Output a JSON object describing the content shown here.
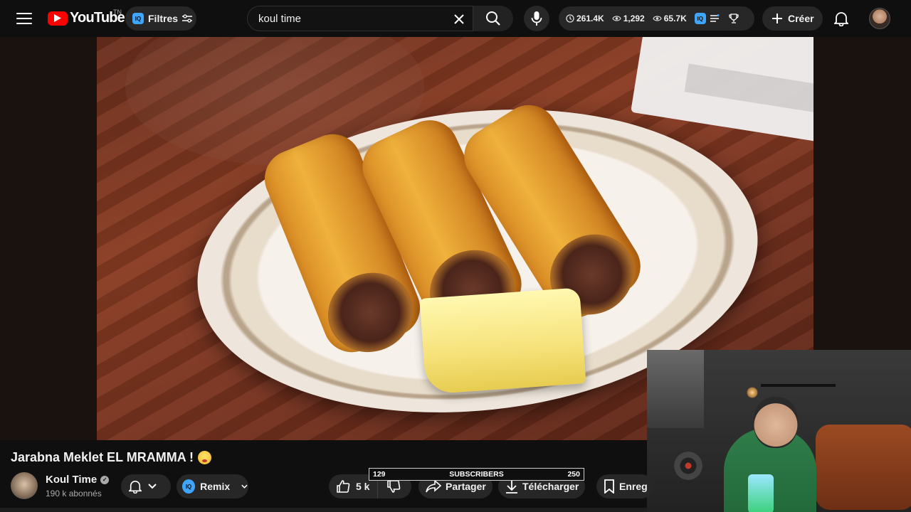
{
  "header": {
    "logo_text": "YouTube",
    "logo_country": "TN",
    "filters_label": "Filtres",
    "search_value": "koul time",
    "stats": {
      "subscribers": "261.4K",
      "views": "1,292",
      "watch": "65.7K"
    },
    "create_label": "Créer",
    "iq_badge": "IQ"
  },
  "video": {
    "title": "Jarabna Meklet EL MRAMMA !",
    "channel_name": "Koul Time",
    "channel_subs": "190 k abonnés"
  },
  "actions": {
    "remix_label": "Remix",
    "like_count": "5 k",
    "share_label": "Partager",
    "download_label": "Télécharger",
    "save_label": "Enreg"
  },
  "subscriber_goal": {
    "start": "129",
    "label": "SUBSCRIBERS",
    "goal": "250",
    "progress": 0.0
  },
  "colors": {
    "brand_red": "#ff0000",
    "iq_blue": "#3ea6ff",
    "pill_bg": "#272727"
  }
}
